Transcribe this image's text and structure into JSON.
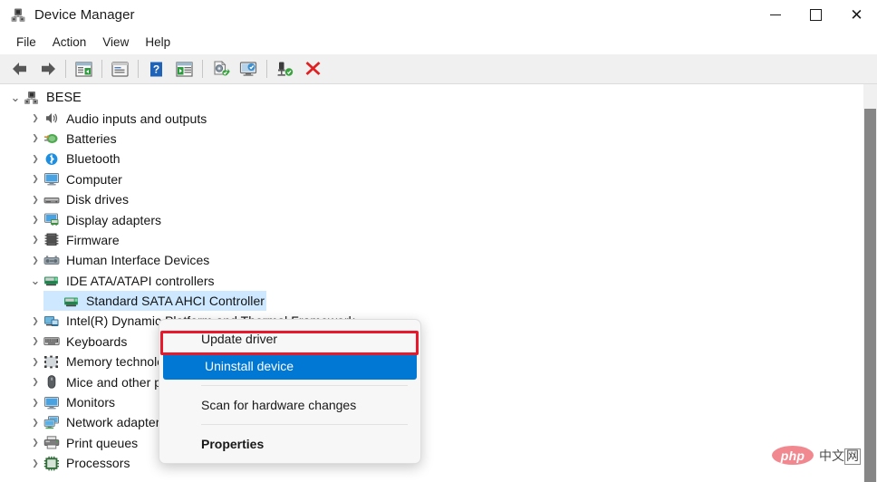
{
  "window": {
    "title": "Device Manager",
    "app_icon": "device-manager-icon",
    "controls": {
      "minimize": "–",
      "maximize": "□",
      "close": "✕"
    }
  },
  "menubar": {
    "items": [
      {
        "label": "File"
      },
      {
        "label": "Action"
      },
      {
        "label": "View"
      },
      {
        "label": "Help"
      }
    ]
  },
  "toolbar": {
    "buttons": [
      {
        "name": "back-arrow-icon",
        "glyph": "←"
      },
      {
        "name": "forward-arrow-icon",
        "glyph": "→"
      },
      {
        "name": "show-hide-console-tree-icon",
        "glyph": ""
      },
      {
        "name": "properties-icon",
        "glyph": ""
      },
      {
        "name": "help-icon",
        "glyph": "?"
      },
      {
        "name": "show-hidden-devices-icon",
        "glyph": ""
      },
      {
        "name": "update-driver-icon",
        "glyph": ""
      },
      {
        "name": "scan-hardware-changes-icon",
        "glyph": ""
      },
      {
        "name": "uninstall-device-icon",
        "glyph": ""
      },
      {
        "name": "disable-device-icon",
        "glyph": "✕"
      }
    ]
  },
  "tree": {
    "root": {
      "label": "BESE",
      "icon": "computer-root-icon",
      "expanded": true
    },
    "items": [
      {
        "label": "Audio inputs and outputs",
        "icon": "speaker-icon",
        "expanded": false,
        "indent": 1
      },
      {
        "label": "Batteries",
        "icon": "battery-icon",
        "expanded": false,
        "indent": 1
      },
      {
        "label": "Bluetooth",
        "icon": "bluetooth-icon",
        "expanded": false,
        "indent": 1
      },
      {
        "label": "Computer",
        "icon": "monitor-icon",
        "expanded": false,
        "indent": 1
      },
      {
        "label": "Disk drives",
        "icon": "disk-drive-icon",
        "expanded": false,
        "indent": 1
      },
      {
        "label": "Display adapters",
        "icon": "display-adapter-icon",
        "expanded": false,
        "indent": 1
      },
      {
        "label": "Firmware",
        "icon": "firmware-chip-icon",
        "expanded": false,
        "indent": 1
      },
      {
        "label": "Human Interface Devices",
        "icon": "hid-icon",
        "expanded": false,
        "indent": 1
      },
      {
        "label": "IDE ATA/ATAPI controllers",
        "icon": "ide-controller-icon",
        "expanded": true,
        "indent": 1
      },
      {
        "label": "Standard SATA AHCI Controller",
        "icon": "ide-controller-icon",
        "expanded": null,
        "indent": 2,
        "selected": true
      },
      {
        "label": "Intel(R) Dynamic Platform and Thermal Framework",
        "icon": "intel-device-icon",
        "expanded": false,
        "indent": 1
      },
      {
        "label": "Keyboards",
        "icon": "keyboard-icon",
        "expanded": false,
        "indent": 1
      },
      {
        "label": "Memory technology devices",
        "icon": "memory-icon",
        "expanded": false,
        "indent": 1
      },
      {
        "label": "Mice and other pointing devices",
        "icon": "mouse-icon",
        "expanded": false,
        "indent": 1
      },
      {
        "label": "Monitors",
        "icon": "monitor-icon",
        "expanded": false,
        "indent": 1
      },
      {
        "label": "Network adapters",
        "icon": "network-adapter-icon",
        "expanded": false,
        "indent": 1
      },
      {
        "label": "Print queues",
        "icon": "printer-icon",
        "expanded": false,
        "indent": 1
      },
      {
        "label": "Processors",
        "icon": "processor-icon",
        "expanded": false,
        "indent": 1
      }
    ],
    "chevron_collapsed": "❯",
    "chevron_expanded": "⌄"
  },
  "context_menu": {
    "items": [
      {
        "label": "Update driver",
        "highlighted": false,
        "bold": false
      },
      {
        "label": "Uninstall device",
        "highlighted": true,
        "bold": false
      },
      {
        "separator_after": true
      },
      {
        "label": "Scan for hardware changes",
        "highlighted": false,
        "bold": false
      },
      {
        "separator_after": true
      },
      {
        "label": "Properties",
        "highlighted": false,
        "bold": true
      }
    ]
  },
  "annotation": {
    "highlight_color": "#e8192c",
    "selection_color": "#0078d4",
    "target_item": "Uninstall device"
  },
  "watermark": {
    "logo_text": "php",
    "site_text_1": "中文",
    "site_text_2": "网"
  }
}
